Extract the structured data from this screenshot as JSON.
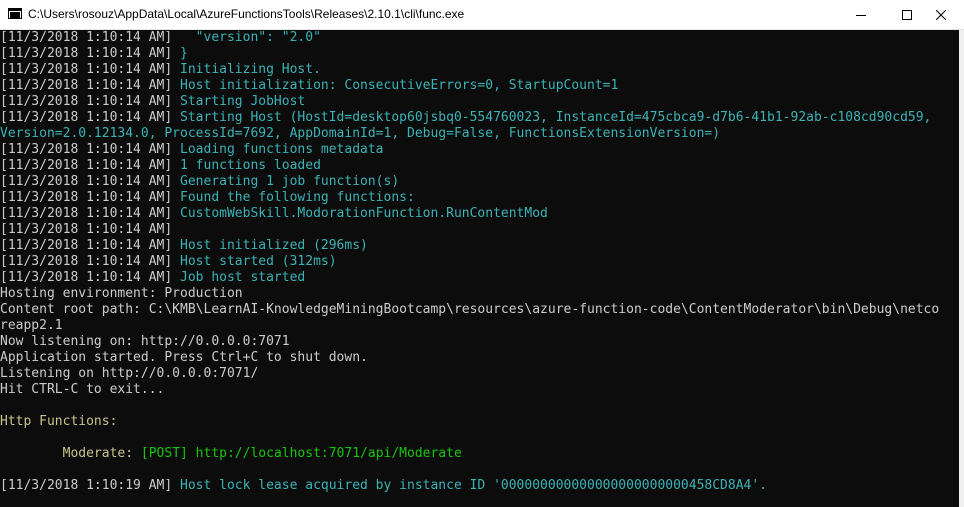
{
  "window": {
    "title": "C:\\Users\\rosouz\\AppData\\Local\\AzureFunctionsTools\\Releases\\2.10.1\\cli\\func.exe",
    "icons": [
      "console-app-icon",
      "minimize-icon",
      "maximize-icon",
      "close-icon"
    ]
  },
  "colors": {
    "background": "#0c0c0c",
    "default_text": "#cccccc",
    "cyan_text": "#3bb3b6",
    "yellow_text": "#c7c38e",
    "green_text": "#16c60c"
  },
  "console": {
    "lines": [
      {
        "ts": "[11/3/2018 1:10:14 AM]",
        "msg": "   \"version\": \"2.0\""
      },
      {
        "ts": "[11/3/2018 1:10:14 AM]",
        "msg": " }"
      },
      {
        "ts": "[11/3/2018 1:10:14 AM]",
        "msg": " Initializing Host."
      },
      {
        "ts": "[11/3/2018 1:10:14 AM]",
        "msg": " Host initialization: ConsecutiveErrors=0, StartupCount=1"
      },
      {
        "ts": "[11/3/2018 1:10:14 AM]",
        "msg": " Starting JobHost"
      },
      {
        "ts": "[11/3/2018 1:10:14 AM]",
        "msg": " Starting Host (HostId=desktop60jsbq0-554760023, InstanceId=475cbca9-d7b6-41b1-92ab-c108cd90cd59,"
      },
      {
        "ts": "",
        "msg": "Version=2.0.12134.0, ProcessId=7692, AppDomainId=1, Debug=False, FunctionsExtensionVersion=)"
      },
      {
        "ts": "[11/3/2018 1:10:14 AM]",
        "msg": " Loading functions metadata"
      },
      {
        "ts": "[11/3/2018 1:10:14 AM]",
        "msg": " 1 functions loaded"
      },
      {
        "ts": "[11/3/2018 1:10:14 AM]",
        "msg": " Generating 1 job function(s)"
      },
      {
        "ts": "[11/3/2018 1:10:14 AM]",
        "msg": " Found the following functions:"
      },
      {
        "ts": "[11/3/2018 1:10:14 AM]",
        "msg": " CustomWebSkill.ModorationFunction.RunContentMod"
      },
      {
        "ts": "[11/3/2018 1:10:14 AM]",
        "msg": ""
      },
      {
        "ts": "[11/3/2018 1:10:14 AM]",
        "msg": " Host initialized (296ms)"
      },
      {
        "ts": "[11/3/2018 1:10:14 AM]",
        "msg": " Host started (312ms)"
      },
      {
        "ts": "[11/3/2018 1:10:14 AM]",
        "msg": " Job host started"
      }
    ],
    "hosting_environment": "Hosting environment: Production",
    "content_root_1": "Content root path: C:\\KMB\\LearnAI-KnowledgeMiningBootcamp\\resources\\azure-function-code\\ContentModerator\\bin\\Debug\\netco",
    "content_root_2": "reapp2.1",
    "now_listening": "Now listening on: http://0.0.0.0:7071",
    "app_started": "Application started. Press Ctrl+C to shut down.",
    "listening_on": "Listening on http://0.0.0.0:7071/",
    "hit_ctrl_c": "Hit CTRL-C to exit...",
    "http_functions_header": "Http Functions:",
    "function_name": "        Moderate:",
    "function_route": " [POST] http://localhost:7071/api/Moderate",
    "last_ts": "[11/3/2018 1:10:19 AM]",
    "last_msg": " Host lock lease acquired by instance ID '000000000000000000000000458CD8A4'."
  }
}
